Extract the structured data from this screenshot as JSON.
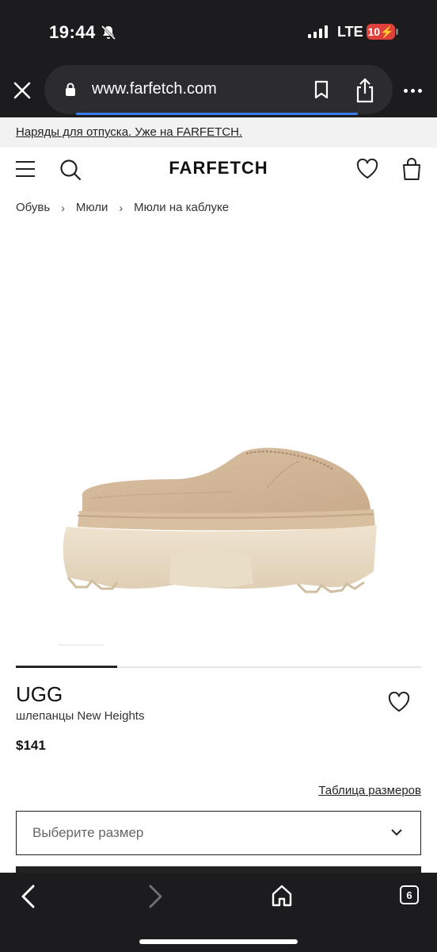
{
  "status_bar": {
    "time": "19:44",
    "network": "LTE",
    "battery": "10"
  },
  "browser": {
    "url": "www.farfetch.com",
    "open_tabs": "6"
  },
  "promo": {
    "text": "Наряды для отпуска. Уже на FARFETCH."
  },
  "header": {
    "logo": "FARFETCH"
  },
  "breadcrumb": {
    "items": [
      "Обувь",
      "Мюли",
      "Мюли на каблуке"
    ],
    "separator": "›"
  },
  "product": {
    "image_alt": "UGG New Heights beige suede clog",
    "brand": "UGG",
    "name": "шлепанцы New Heights",
    "price": "$141",
    "color": "#d4b99a"
  },
  "size": {
    "chart_link": "Таблица размеров",
    "select_placeholder": "Выберите размер"
  },
  "icons": {
    "close": "close-icon",
    "lock": "lock-icon",
    "bookmark": "bookmark-icon",
    "share": "share-icon",
    "more": "more-icon",
    "menu": "hamburger-icon",
    "search": "search-icon",
    "wishlist": "heart-icon",
    "bag": "bag-icon",
    "back": "back-icon",
    "forward": "forward-icon",
    "home": "home-icon"
  }
}
